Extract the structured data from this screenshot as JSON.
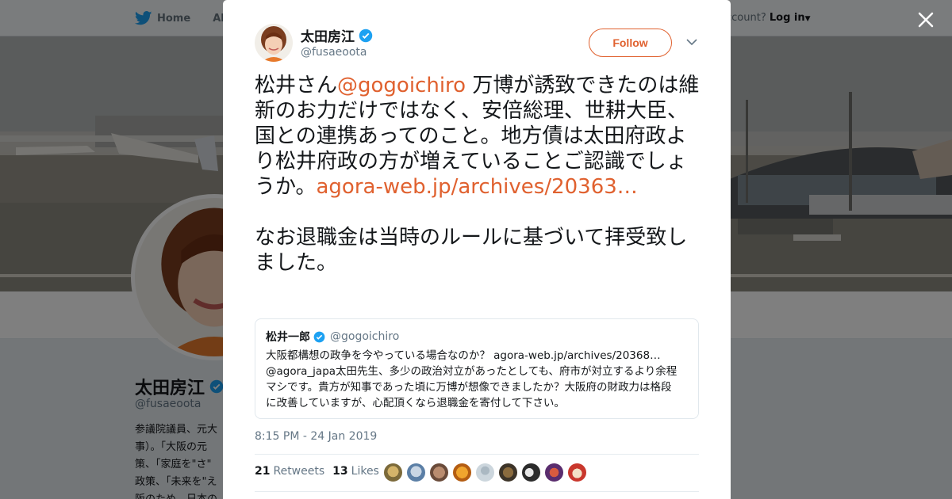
{
  "background": {
    "nav": {
      "home_label": "Home",
      "about_label": "Abo",
      "login_prefix": "ccount?",
      "login_label": "Log in"
    },
    "profile": {
      "name": "太田房江",
      "handle": "@fusaeoota",
      "bio": "参議院議員、元大\n事）。「大阪の元\n策、「家庭を\"さ\"\n政策、「未来を\"え\n阪のため、日本の"
    }
  },
  "tweet": {
    "author": {
      "name": "太田房江",
      "handle": "@fusaeoota",
      "verified": true
    },
    "follow_label": "Follow",
    "text": {
      "part1": "松井さん",
      "mention": "@gogoichiro",
      "part2": " 万博が誘致できたのは維新のお力だけではなく、安倍総理、世耕大臣、国との連携あってのこと。地方債は太田府政より松井府政の方が増えていることご認識でしょうか。",
      "link": "agora-web.jp/archives/20363…",
      "paragraph2": "なお退職金は当時のルールに基づいて拝受致しました。"
    },
    "quoted": {
      "name": "松井一郎",
      "handle": "@gogoichiro",
      "verified": true,
      "lines": [
        "大阪都構想の政争を今やっている場合なのか？ agora-web.jp/archives/20368…",
        "@agora_japa太田先生、多少の政治対立があったとしても、府市が対立するより余程",
        "マシです。貴方が知事であった頃に万博が想像できましたか？大阪府の財政力は格段",
        "に改善していますが、心配頂くなら退職金を寄付して下さい。"
      ]
    },
    "timestamp": "8:15 PM - 24 Jan 2019",
    "stats": {
      "retweets_count": "21",
      "retweets_label": "Retweets",
      "likes_count": "13",
      "likes_label": "Likes"
    }
  },
  "colors": {
    "accent": "#e0612f",
    "verified": "#1da1f2",
    "text": "#14171a",
    "muted": "#657786"
  }
}
